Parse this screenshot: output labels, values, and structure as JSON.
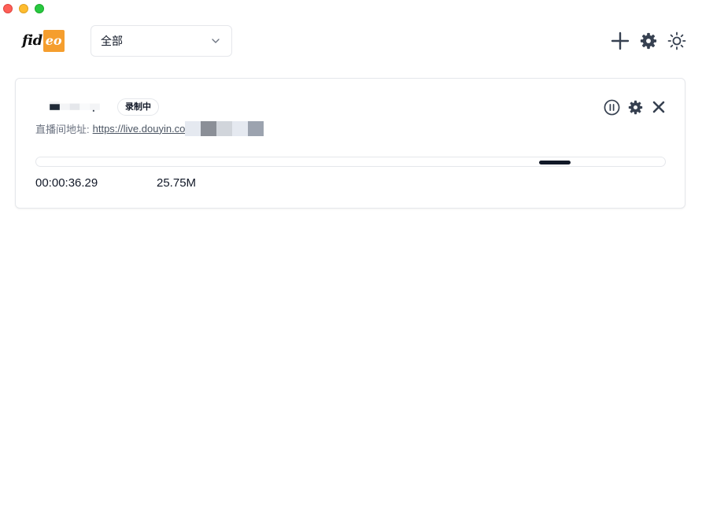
{
  "window": {
    "controls": [
      "close",
      "minimize",
      "maximize"
    ]
  },
  "header": {
    "logo": {
      "left": "fid",
      "right": "eo"
    },
    "filter": {
      "selected": "全部",
      "icon": "chevron-down-icon"
    },
    "toolbar": [
      {
        "name": "add-icon",
        "action": "add"
      },
      {
        "name": "gear-icon",
        "action": "settings"
      },
      {
        "name": "sun-icon",
        "action": "theme"
      }
    ]
  },
  "card": {
    "status_badge": "录制中",
    "url_label": "直播间地址:",
    "url_text": "https://live.douyin.co",
    "progress": {
      "indeterminate": true,
      "position_fraction": 0.8
    },
    "duration": "00:00:36.29",
    "size": "25.75M",
    "actions": [
      {
        "name": "pause-icon",
        "action": "pause"
      },
      {
        "name": "gear-icon",
        "action": "settings"
      },
      {
        "name": "close-icon",
        "action": "remove"
      }
    ]
  },
  "colors": {
    "accent": "#f59e2e",
    "text": "#111827",
    "muted": "#6b7280",
    "border": "#e5e7eb"
  }
}
